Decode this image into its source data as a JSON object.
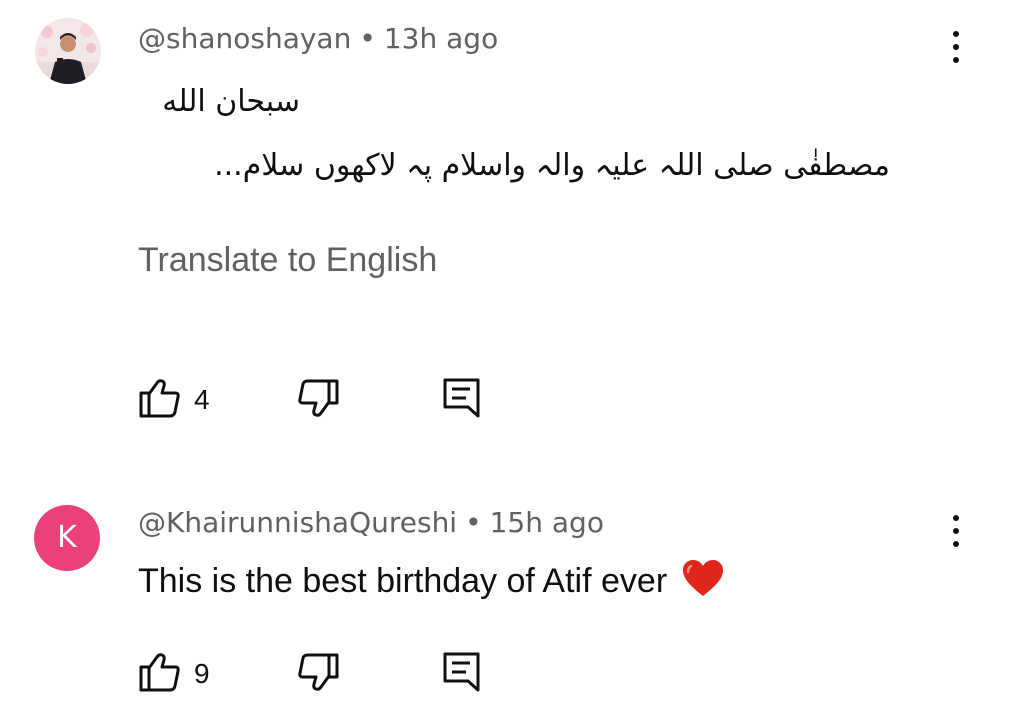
{
  "comments": [
    {
      "handle": "@shanoshayan",
      "separator": "•",
      "time": "13h ago",
      "avatar_icon": "user-photo-avatar",
      "text_lines": [
        "سبحان الله",
        "مصطفٰی صلی اللہ علیہ والہ واسلام پہ لاکھوں سلام..."
      ],
      "translate_label": "Translate to English",
      "like_count": "4",
      "more_icon": "more-vert-icon"
    },
    {
      "handle": "@KhairunnishaQureshi",
      "separator": "•",
      "time": "15h ago",
      "avatar_letter": "K",
      "avatar_color": "#ec407a",
      "text": "This is the best birthday of Atif ever",
      "emoji_icon": "red-heart-icon",
      "like_count": "9",
      "more_icon": "more-vert-icon"
    }
  ],
  "colors": {
    "secondary_text": "#606060",
    "primary_text": "#0f0f0f",
    "heart": "#e0261b"
  }
}
